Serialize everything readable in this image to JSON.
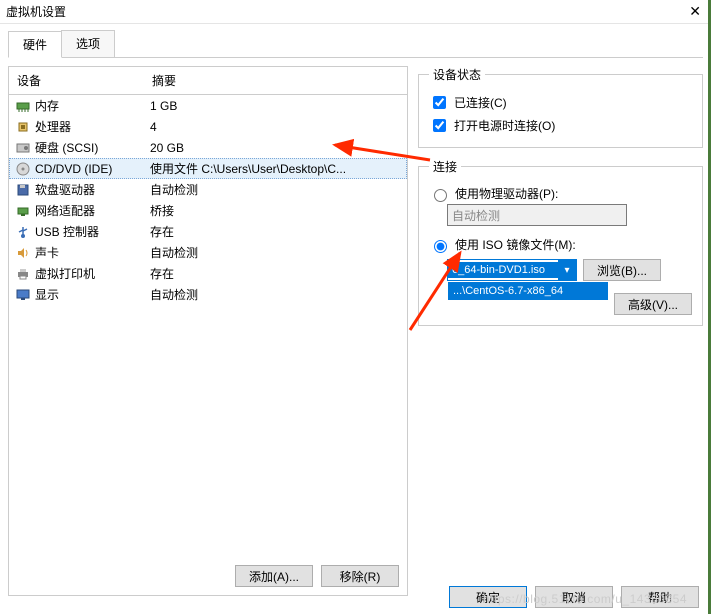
{
  "window": {
    "title": "虚拟机设置"
  },
  "tabs": {
    "hardware": "硬件",
    "options": "选项"
  },
  "columns": {
    "device": "设备",
    "summary": "摘要"
  },
  "devices": [
    {
      "icon": "memory-icon",
      "name": "内存",
      "summary": "1 GB",
      "selected": false
    },
    {
      "icon": "cpu-icon",
      "name": "处理器",
      "summary": "4",
      "selected": false
    },
    {
      "icon": "disk-icon",
      "name": "硬盘 (SCSI)",
      "summary": "20 GB",
      "selected": false
    },
    {
      "icon": "cd-icon",
      "name": "CD/DVD (IDE)",
      "summary": "使用文件 C:\\Users\\User\\Desktop\\C...",
      "selected": true
    },
    {
      "icon": "floppy-icon",
      "name": "软盘驱动器",
      "summary": "自动检测",
      "selected": false
    },
    {
      "icon": "network-icon",
      "name": "网络适配器",
      "summary": "桥接",
      "selected": false
    },
    {
      "icon": "usb-icon",
      "name": "USB 控制器",
      "summary": "存在",
      "selected": false
    },
    {
      "icon": "sound-icon",
      "name": "声卡",
      "summary": "自动检测",
      "selected": false
    },
    {
      "icon": "printer-icon",
      "name": "虚拟打印机",
      "summary": "存在",
      "selected": false
    },
    {
      "icon": "display-icon",
      "name": "显示",
      "summary": "自动检测",
      "selected": false
    }
  ],
  "dev_buttons": {
    "add": "添加(A)...",
    "remove": "移除(R)"
  },
  "status_group": {
    "legend": "设备状态",
    "connected": "已连接(C)",
    "connect_at_power_on": "打开电源时连接(O)"
  },
  "connection_group": {
    "legend": "连接",
    "use_physical": "使用物理驱动器(P):",
    "auto_detect": "自动检测",
    "use_iso": "使用 ISO 镜像文件(M):",
    "iso_value": "6_64-bin-DVD1.iso",
    "iso_dropdown": "...\\CentOS-6.7-x86_64",
    "browse": "浏览(B)...",
    "advanced": "高级(V)..."
  },
  "footer": {
    "ok": "确定",
    "cancel": "取消",
    "help": "帮助"
  },
  "watermark": "https://blog.51cto.com/u_14380854"
}
